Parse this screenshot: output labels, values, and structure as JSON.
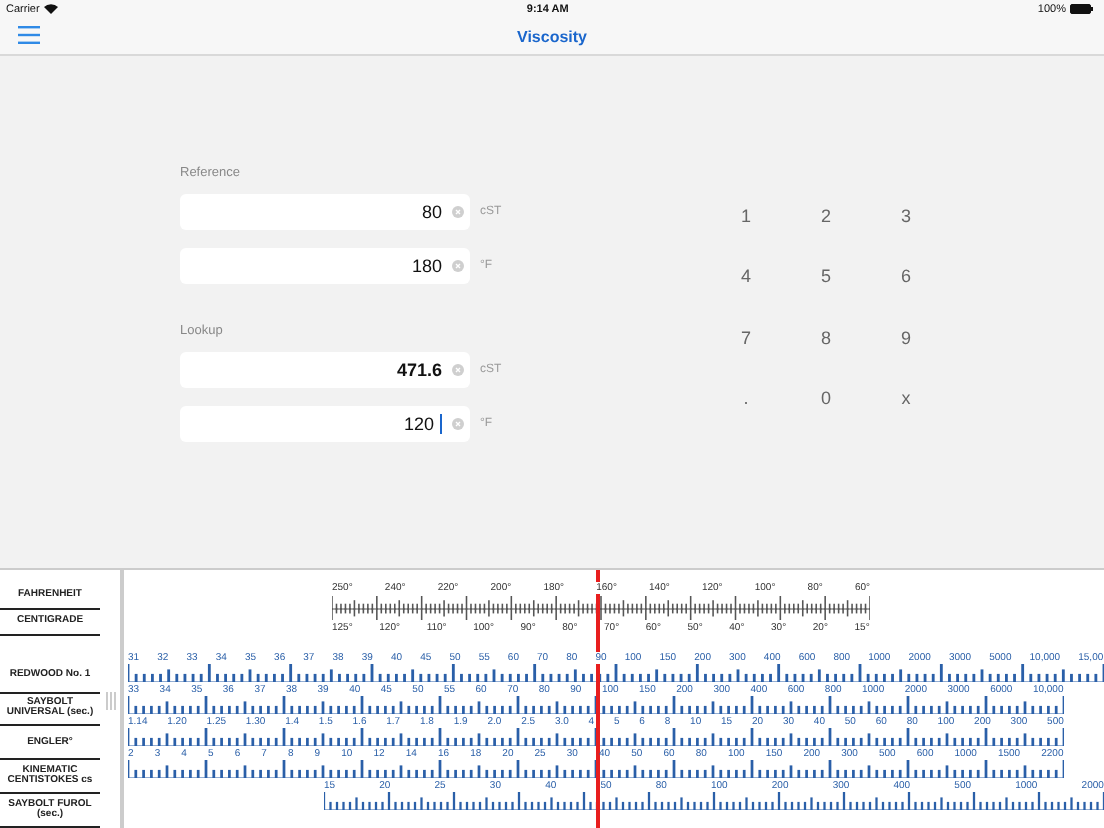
{
  "status_bar": {
    "carrier": "Carrier",
    "time": "9:14 AM",
    "battery": "100%"
  },
  "nav": {
    "title": "Viscosity"
  },
  "sections": [
    {
      "label": "Reference",
      "fields": [
        {
          "value": "80",
          "unit": "cST",
          "focused": false
        },
        {
          "value": "180",
          "unit": "°F",
          "focused": false
        }
      ]
    },
    {
      "label": "Lookup",
      "fields": [
        {
          "value": "471.6",
          "unit": "cST",
          "focused": false
        },
        {
          "value": "120",
          "unit": "°F",
          "focused": true
        }
      ]
    }
  ],
  "keypad": [
    "1",
    "2",
    "3",
    "4",
    "5",
    "6",
    "7",
    "8",
    "9",
    ".",
    "0",
    "x"
  ],
  "temperature": {
    "top_name": "FAHRENHEIT",
    "bottom_name": "CENTIGRADE",
    "top_labels": [
      "250°",
      "240°",
      "220°",
      "200°",
      "180°",
      "160°",
      "140°",
      "120°",
      "100°",
      "80°",
      "60°"
    ],
    "bottom_labels": [
      "125°",
      "120°",
      "110°",
      "100°",
      "90°",
      "80°",
      "70°",
      "60°",
      "50°",
      "40°",
      "30°",
      "20°",
      "15°"
    ]
  },
  "scales": [
    {
      "name": "REDWOOD No. 1",
      "labels": [
        "31",
        "32",
        "33",
        "34",
        "35",
        "36",
        "37",
        "38",
        "39",
        "40",
        "45",
        "50",
        "55",
        "60",
        "70",
        "80",
        "90",
        "100",
        "150",
        "200",
        "300",
        "400",
        "600",
        "800",
        "1000",
        "2000",
        "3000",
        "5000",
        "10,000",
        "15,00"
      ]
    },
    {
      "name": "SAYBOLT UNIVERSAL (sec.)",
      "labels": [
        "33",
        "34",
        "35",
        "36",
        "37",
        "38",
        "39",
        "40",
        "45",
        "50",
        "55",
        "60",
        "70",
        "80",
        "90",
        "100",
        "150",
        "200",
        "300",
        "400",
        "600",
        "800",
        "1000",
        "2000",
        "3000",
        "6000",
        "10,000"
      ]
    },
    {
      "name": "ENGLER°",
      "labels": [
        "1.14",
        "1.20",
        "1.25",
        "1.30",
        "1.4",
        "1.5",
        "1.6",
        "1.7",
        "1.8",
        "1.9",
        "2.0",
        "2.5",
        "3.0",
        "4",
        "5",
        "6",
        "8",
        "10",
        "15",
        "20",
        "30",
        "40",
        "50",
        "60",
        "80",
        "100",
        "200",
        "300",
        "500"
      ]
    },
    {
      "name": "KINEMATIC CENTISTOKES cs",
      "labels": [
        "2",
        "3",
        "4",
        "5",
        "6",
        "7",
        "8",
        "9",
        "10",
        "12",
        "14",
        "16",
        "18",
        "20",
        "25",
        "30",
        "40",
        "50",
        "60",
        "80",
        "100",
        "150",
        "200",
        "300",
        "500",
        "600",
        "1000",
        "1500",
        "2200"
      ]
    },
    {
      "name": "SAYBOLT FUROL (sec.)",
      "labels": [
        "15",
        "20",
        "25",
        "30",
        "40",
        "50",
        "80",
        "100",
        "200",
        "300",
        "400",
        "500",
        "1000",
        "2000"
      ]
    }
  ]
}
